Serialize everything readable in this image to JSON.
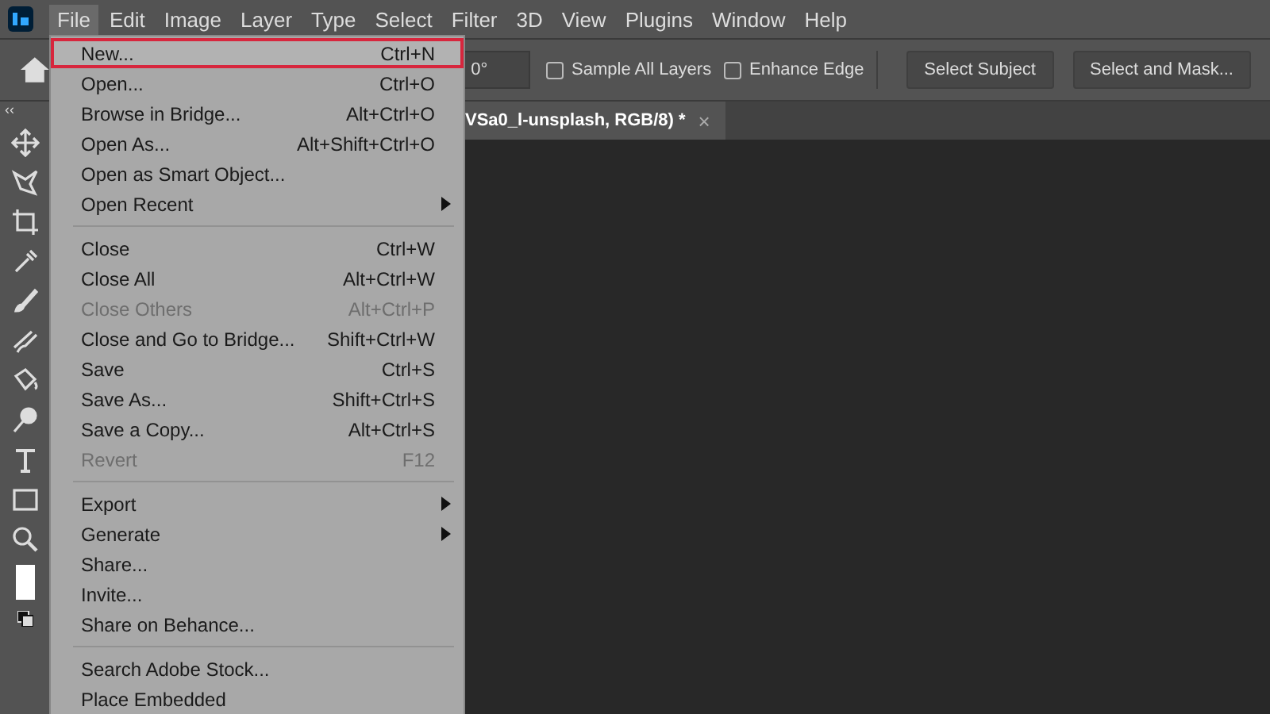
{
  "menubar": [
    {
      "label": "File",
      "selected": true
    },
    {
      "label": "Edit",
      "selected": false
    },
    {
      "label": "Image",
      "selected": false
    },
    {
      "label": "Layer",
      "selected": false
    },
    {
      "label": "Type",
      "selected": false
    },
    {
      "label": "Select",
      "selected": false
    },
    {
      "label": "Filter",
      "selected": false
    },
    {
      "label": "3D",
      "selected": false
    },
    {
      "label": "View",
      "selected": false
    },
    {
      "label": "Plugins",
      "selected": false
    },
    {
      "label": "Window",
      "selected": false
    },
    {
      "label": "Help",
      "selected": false
    }
  ],
  "options_bar": {
    "angle": "0°",
    "checkboxes": [
      {
        "label": "Sample All Layers",
        "checked": false
      },
      {
        "label": "Enhance Edge",
        "checked": false
      }
    ],
    "buttons": [
      "Select Subject",
      "Select and Mask..."
    ]
  },
  "collapse": "‹‹",
  "tab": {
    "title": "VSa0_l-unsplash, RGB/8) *",
    "close": "×"
  },
  "file_menu": [
    [
      {
        "label": "New...",
        "shortcut": "Ctrl+N",
        "disabled": false,
        "submenu": false,
        "selected": true
      },
      {
        "label": "Open...",
        "shortcut": "Ctrl+O",
        "disabled": false,
        "submenu": false,
        "selected": false
      },
      {
        "label": "Browse in Bridge...",
        "shortcut": "Alt+Ctrl+O",
        "disabled": false,
        "submenu": false,
        "selected": false
      },
      {
        "label": "Open As...",
        "shortcut": "Alt+Shift+Ctrl+O",
        "disabled": false,
        "submenu": false,
        "selected": false
      },
      {
        "label": "Open as Smart Object...",
        "disabled": false,
        "submenu": false,
        "selected": false
      },
      {
        "label": "Open Recent",
        "disabled": false,
        "submenu": true,
        "selected": false
      }
    ],
    [
      {
        "label": "Close",
        "shortcut": "Ctrl+W",
        "disabled": false,
        "submenu": false,
        "selected": false
      },
      {
        "label": "Close All",
        "shortcut": "Alt+Ctrl+W",
        "disabled": false,
        "submenu": false,
        "selected": false
      },
      {
        "label": "Close Others",
        "shortcut": "Alt+Ctrl+P",
        "disabled": true,
        "submenu": false,
        "selected": false
      },
      {
        "label": "Close and Go to Bridge...",
        "shortcut": "Shift+Ctrl+W",
        "disabled": false,
        "submenu": false,
        "selected": false
      },
      {
        "label": "Save",
        "shortcut": "Ctrl+S",
        "disabled": false,
        "submenu": false,
        "selected": false
      },
      {
        "label": "Save As...",
        "shortcut": "Shift+Ctrl+S",
        "disabled": false,
        "submenu": false,
        "selected": false
      },
      {
        "label": "Save a Copy...",
        "shortcut": "Alt+Ctrl+S",
        "disabled": false,
        "submenu": false,
        "selected": false
      },
      {
        "label": "Revert",
        "shortcut": "F12",
        "disabled": true,
        "submenu": false,
        "selected": false
      }
    ],
    [
      {
        "label": "Export",
        "disabled": false,
        "submenu": true,
        "selected": false
      },
      {
        "label": "Generate",
        "disabled": false,
        "submenu": true,
        "selected": false
      },
      {
        "label": "Share...",
        "disabled": false,
        "submenu": false,
        "selected": false
      },
      {
        "label": "Invite...",
        "disabled": false,
        "submenu": false,
        "selected": false
      },
      {
        "label": "Share on Behance...",
        "disabled": false,
        "submenu": false,
        "selected": false
      }
    ],
    [
      {
        "label": "Search Adobe Stock...",
        "disabled": false,
        "submenu": false,
        "selected": false
      },
      {
        "label": "Place Embedded",
        "disabled": false,
        "submenu": false,
        "selected": false
      }
    ]
  ]
}
